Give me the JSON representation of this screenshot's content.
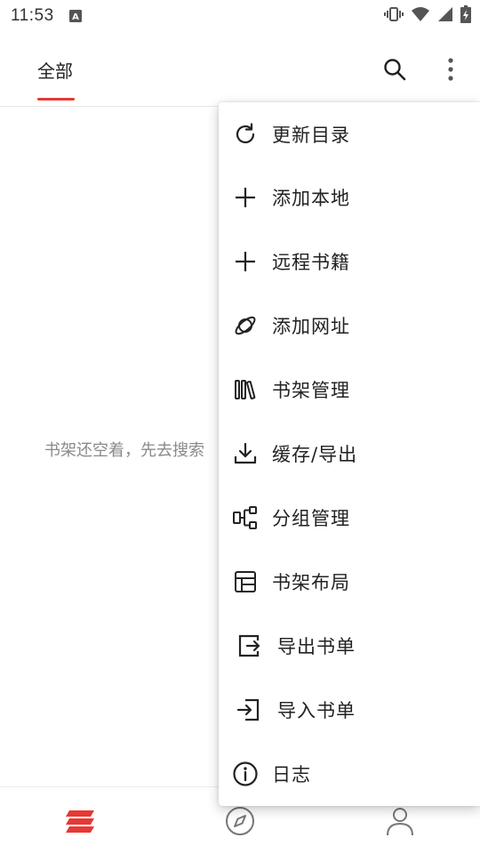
{
  "status_bar": {
    "time": "11:53",
    "icons": [
      "a-notification-icon",
      "vibrate-icon",
      "wifi-icon",
      "signal-icon",
      "battery-charging-icon"
    ]
  },
  "top_bar": {
    "tab_label": "全部",
    "accent_color": "#e53935",
    "icons": [
      "search-icon",
      "more-vert-icon"
    ]
  },
  "empty_state": {
    "message": "书架还空着，先去搜索"
  },
  "menu": {
    "items": [
      {
        "label": "更新目录",
        "icon": "refresh-icon"
      },
      {
        "label": "添加本地",
        "icon": "plus-icon"
      },
      {
        "label": "远程书籍",
        "icon": "plus-icon"
      },
      {
        "label": "添加网址",
        "icon": "planet-icon"
      },
      {
        "label": "书架管理",
        "icon": "bookshelf-icon"
      },
      {
        "label": "缓存/导出",
        "icon": "download-icon"
      },
      {
        "label": "分组管理",
        "icon": "group-icon"
      },
      {
        "label": "书架布局",
        "icon": "layout-icon"
      },
      {
        "label": "导出书单",
        "icon": "export-icon"
      },
      {
        "label": "导入书单",
        "icon": "import-icon"
      },
      {
        "label": "日志",
        "icon": "info-icon"
      }
    ]
  },
  "bottom_nav": {
    "items": [
      "bookshelf-nav-icon",
      "explore-nav-icon",
      "profile-nav-icon"
    ],
    "active_color": "#e53935"
  }
}
